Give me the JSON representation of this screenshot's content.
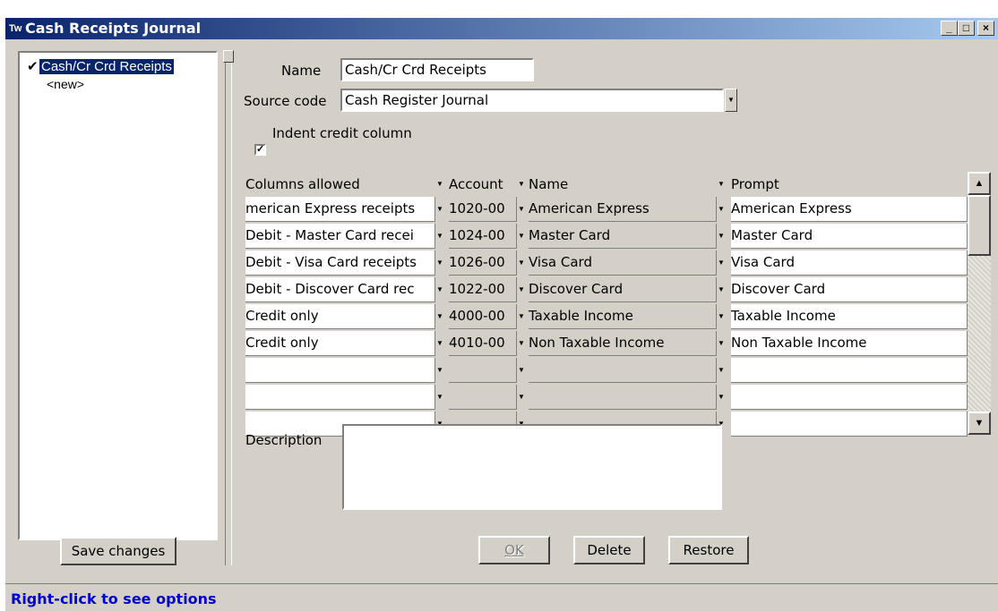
{
  "window": {
    "title": "Cash Receipts Journal",
    "app_icon": "tw-app-icon",
    "minimize_icon": "_",
    "maximize_icon": "□",
    "close_icon": "×"
  },
  "left_panel": {
    "items": [
      {
        "label": "Cash/Cr Crd Receipts",
        "checked": true,
        "selected": true
      },
      {
        "label": "<new>",
        "checked": false,
        "selected": false
      }
    ],
    "save_button": "Save changes"
  },
  "form": {
    "name_label": "Name",
    "name_value": "Cash/Cr Crd Receipts",
    "source_code_label": "Source code",
    "source_code_value": "Cash Register Journal",
    "indent_label": "Indent credit column",
    "indent_checked": true,
    "description_label": "Description",
    "description_value": ""
  },
  "grid": {
    "headers": [
      "Columns allowed",
      "Account",
      "Name",
      "Prompt"
    ],
    "rows": [
      [
        "merican Express receipts",
        "1020-00",
        "American Express",
        "American Express"
      ],
      [
        "Debit - Master Card recei",
        "1024-00",
        "Master Card",
        "Master Card"
      ],
      [
        "Debit - Visa Card receipts",
        "1026-00",
        "Visa Card",
        "Visa Card"
      ],
      [
        "Debit - Discover Card rec",
        "1022-00",
        "Discover Card",
        "Discover Card"
      ],
      [
        "Credit only",
        "4000-00",
        "Taxable Income",
        "Taxable Income"
      ],
      [
        "Credit only",
        "4010-00",
        "Non Taxable Income",
        "Non Taxable Income"
      ],
      [
        "",
        "",
        "",
        ""
      ],
      [
        "",
        "",
        "",
        ""
      ],
      [
        "",
        "",
        "",
        ""
      ]
    ]
  },
  "buttons": {
    "ok": "OK",
    "delete": "Delete",
    "restore": "Restore"
  },
  "status": {
    "text": "Right-click to see options"
  }
}
